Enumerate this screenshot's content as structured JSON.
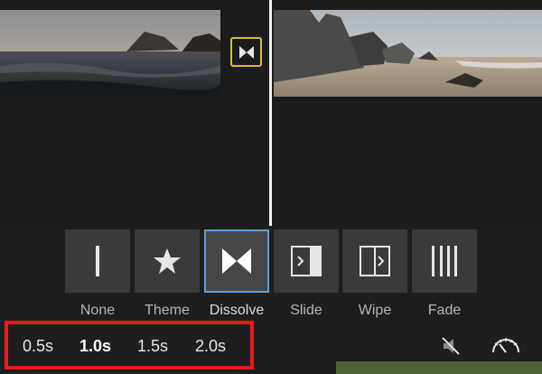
{
  "timeline": {
    "transition_icon": "dissolve-icon"
  },
  "transitions": [
    {
      "label": "None",
      "icon": "none-icon"
    },
    {
      "label": "Theme",
      "icon": "star-icon"
    },
    {
      "label": "Dissolve",
      "icon": "dissolve-icon"
    },
    {
      "label": "Slide",
      "icon": "slide-icon"
    },
    {
      "label": "Wipe",
      "icon": "wipe-icon"
    },
    {
      "label": "Fade",
      "icon": "fade-icon"
    }
  ],
  "selected_transition": "Dissolve",
  "durations": [
    "0.5s",
    "1.0s",
    "1.5s",
    "2.0s"
  ],
  "selected_duration": "1.0s",
  "controls": {
    "mute_icon": "mute-icon",
    "speed_icon": "speedometer-icon"
  },
  "colors": {
    "selection_border": "#5aa0d8",
    "marker_border": "#d9b94a",
    "highlight_box": "#e51b1b"
  }
}
